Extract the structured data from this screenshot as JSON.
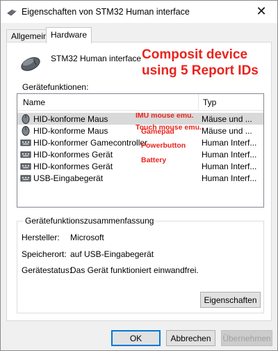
{
  "window": {
    "title": "Eigenschaften von STM32 Human interface",
    "close_glyph": "✕"
  },
  "tabs": [
    {
      "label": "Allgemein"
    },
    {
      "label": "Hardware"
    }
  ],
  "device": {
    "name": "STM32 Human interface",
    "icon": "mouse-icon"
  },
  "annotation": {
    "line1": "Composit device",
    "line2": "using 5 Report IDs"
  },
  "functions": {
    "label": "Gerätefunktionen:",
    "columns": {
      "name": "Name",
      "type": "Typ"
    },
    "rows": [
      {
        "name": "HID-konforme Maus",
        "type": "Mäuse und ...",
        "icon": "mouse-icon",
        "note": "IMU mouse emu."
      },
      {
        "name": "HID-konforme Maus",
        "type": "Mäuse und ...",
        "icon": "mouse-icon",
        "note": "Touch mouse emu."
      },
      {
        "name": "HID-konformer Gamecontroller",
        "type": "Human Interf...",
        "icon": "hid-device-icon",
        "note": "Gamepad"
      },
      {
        "name": "HID-konformes Gerät",
        "type": "Human Interf...",
        "icon": "hid-device-icon",
        "note": "Powerbutton"
      },
      {
        "name": "HID-konformes Gerät",
        "type": "Human Interf...",
        "icon": "hid-device-icon",
        "note": "Battery"
      },
      {
        "name": "USB-Eingabegerät",
        "type": "Human Interf...",
        "icon": "hid-device-icon",
        "note": ""
      }
    ]
  },
  "summary": {
    "title": "Gerätefunktionszusammenfassung",
    "manufacturer_label": "Hersteller:",
    "manufacturer": "Microsoft",
    "location_label": "Speicherort:",
    "location": "auf USB-Eingabegerät",
    "status_label": "Gerätestatus:",
    "status": "Das Gerät funktioniert einwandfrei.",
    "properties_button": "Eigenschaften"
  },
  "buttons": {
    "ok": "OK",
    "cancel": "Abbrechen",
    "apply": "Übernehmen"
  },
  "colors": {
    "annotation": "#e8241d",
    "selection": "#d9d9d9",
    "focus": "#0078d7"
  }
}
